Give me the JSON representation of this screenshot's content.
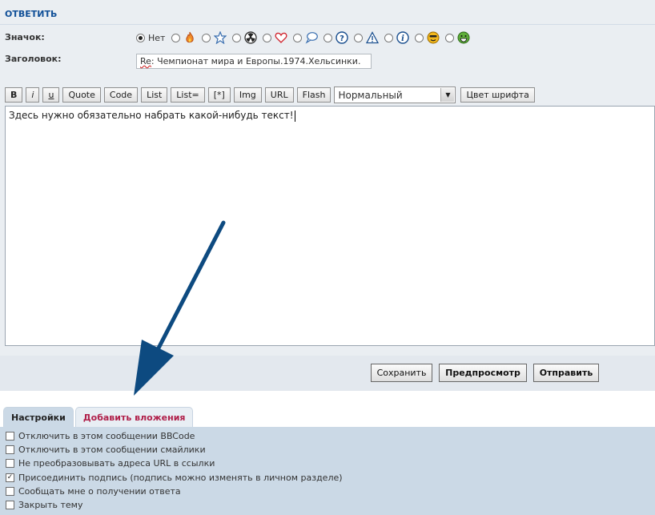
{
  "heading": "ОТВЕТИТЬ",
  "icon_field": {
    "label": "Значок:",
    "none_label": "Нет",
    "icons": [
      "fire-icon",
      "star-icon",
      "radioactive-icon",
      "heart-icon",
      "speech-bubble-icon",
      "question-icon",
      "warning-icon",
      "info-icon",
      "smiley-icon",
      "grin-icon"
    ]
  },
  "subject_field": {
    "label": "Заголовок:",
    "value_prefix": "Re",
    "value_rest": ": Чемпионат мира и Европы.1974.Хельсинки."
  },
  "toolbar": {
    "buttons": [
      "B",
      "i",
      "u",
      "Quote",
      "Code",
      "List",
      "List=",
      "[*]",
      "Img",
      "URL",
      "Flash"
    ],
    "font_size": "Нормальный",
    "font_color_label": "Цвет шрифта"
  },
  "editor": {
    "text": "Здесь нужно обязательно набрать какой-нибудь текст!"
  },
  "actions": {
    "save": "Сохранить",
    "preview": "Предпросмотр",
    "submit": "Отправить"
  },
  "tabs": {
    "settings": "Настройки",
    "attachments": "Добавить вложения"
  },
  "options": [
    {
      "label": "Отключить в этом сообщении BBCode",
      "checked": false
    },
    {
      "label": "Отключить в этом сообщении смайлики",
      "checked": false
    },
    {
      "label": "Не преобразовывать адреса URL в ссылки",
      "checked": false
    },
    {
      "label": "Присоединить подпись (подпись можно изменять в личном разделе)",
      "checked": true
    },
    {
      "label": "Сообщать мне о получении ответа",
      "checked": false
    },
    {
      "label": "Закрыть тему",
      "checked": false
    }
  ],
  "colors": {
    "heading": "#115098",
    "panel": "#eaeef2",
    "options_bg": "#cbd9e6",
    "inactive_tab_text": "#b0204a",
    "annotation_arrow": "#0d4a80"
  }
}
